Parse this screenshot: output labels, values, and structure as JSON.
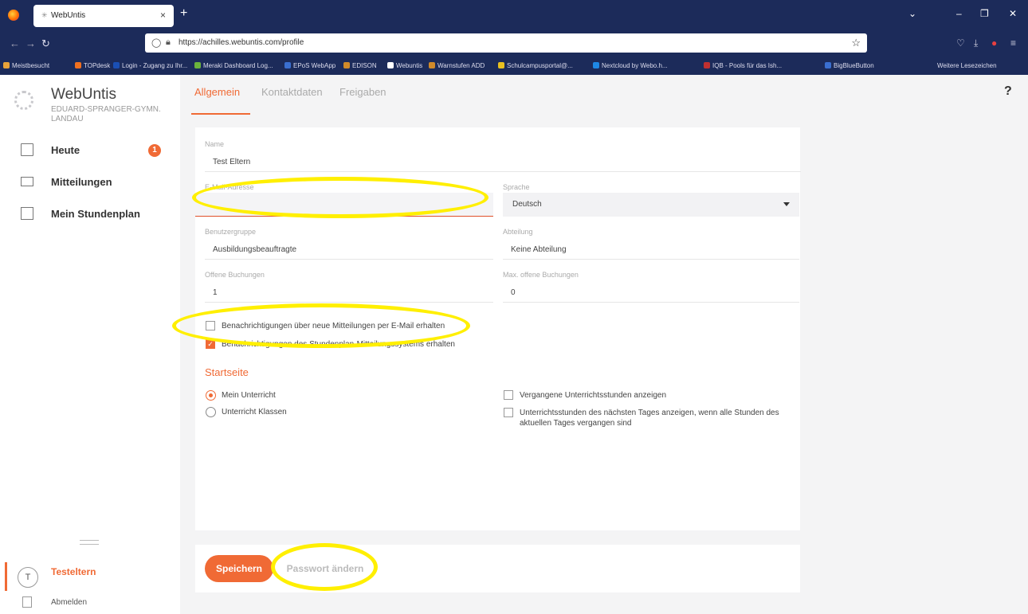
{
  "browser": {
    "tab_title": "WebUntis",
    "tab_close": "×",
    "new_tab": "+",
    "url": "https://achilles.webuntis.com/profile",
    "window_controls": [
      "⌄",
      "–",
      "❐",
      "✕"
    ],
    "bookmarks": [
      {
        "label": "Meistbesucht",
        "color": "#e8a33a"
      },
      {
        "label": "TOPdesk",
        "color": "#f07020"
      },
      {
        "label": "Login - Zugang zu Ihr...",
        "color": "#1a4fb4"
      },
      {
        "label": "Meraki Dashboard Log...",
        "color": "#6bb33c"
      },
      {
        "label": "EPoS WebApp",
        "color": "#3a6fd0"
      },
      {
        "label": "EDISON",
        "color": "#d08a2a"
      },
      {
        "label": "Webuntis",
        "color": "#ffffff"
      },
      {
        "label": "Warnstufen ADD",
        "color": "#d08a2a"
      },
      {
        "label": "Schulcampusportal@...",
        "color": "#e8c020"
      },
      {
        "label": "Nextcloud by Webo.h...",
        "color": "#1e88e5"
      },
      {
        "label": "IQB - Pools für das Ish...",
        "color": "#c03030"
      },
      {
        "label": "BigBlueButton",
        "color": "#3a6fd0"
      }
    ],
    "more_bookmarks": "Weitere Lesezeichen"
  },
  "sidebar": {
    "app_name": "WebUntis",
    "school_line1": "EDUARD-SPRANGER-GYMN.",
    "school_line2": "LANDAU",
    "items": [
      {
        "label": "Heute",
        "badge": "1"
      },
      {
        "label": "Mitteilungen"
      },
      {
        "label": "Mein Stundenplan"
      }
    ],
    "user_initial": "T",
    "user_name": "Testeltern",
    "logout_label": "Abmelden"
  },
  "tabs": [
    {
      "label": "Allgemein",
      "active": true
    },
    {
      "label": "Kontaktdaten",
      "active": false
    },
    {
      "label": "Freigaben",
      "active": false
    }
  ],
  "help": "?",
  "form": {
    "name_label": "Name",
    "name_value": "Test Eltern",
    "email_label": "E-Mail-Adresse",
    "email_value": "",
    "language_label": "Sprache",
    "language_value": "Deutsch",
    "usergroup_label": "Benutzergruppe",
    "usergroup_value": "Ausbildungsbeauftragte",
    "department_label": "Abteilung",
    "department_value": "Keine Abteilung",
    "open_bookings_label": "Offene Buchungen",
    "open_bookings_value": "1",
    "max_open_bookings_label": "Max. offene Buchungen",
    "max_open_bookings_value": "0",
    "check_email_notifications": {
      "label": "Benachrichtigungen über neue Mitteilungen per E-Mail erhalten",
      "checked": false
    },
    "check_system_notifications": {
      "label": "Benachrichtigungen des Stundenplan-Mitteilungssystems erhalten",
      "checked": true
    },
    "startpage_title": "Startseite",
    "radio_my_lessons": {
      "label": "Mein Unterricht",
      "selected": true
    },
    "radio_class_lessons": {
      "label": "Unterricht Klassen",
      "selected": false
    },
    "check_past_lessons": {
      "label": "Vergangene Unterrichtsstunden anzeigen",
      "checked": false
    },
    "check_next_day_line1": "Unterrichtsstunden des nächsten Tages anzeigen, wenn alle Stunden des",
    "check_next_day_line2": "aktuellen Tages vergangen sind"
  },
  "actions": {
    "save_label": "Speichern",
    "change_password_label": "Passwort ändern"
  },
  "colors": {
    "accent": "#f06a35",
    "annotation": "#ffef00",
    "browser_chrome": "#1c2b5a"
  }
}
